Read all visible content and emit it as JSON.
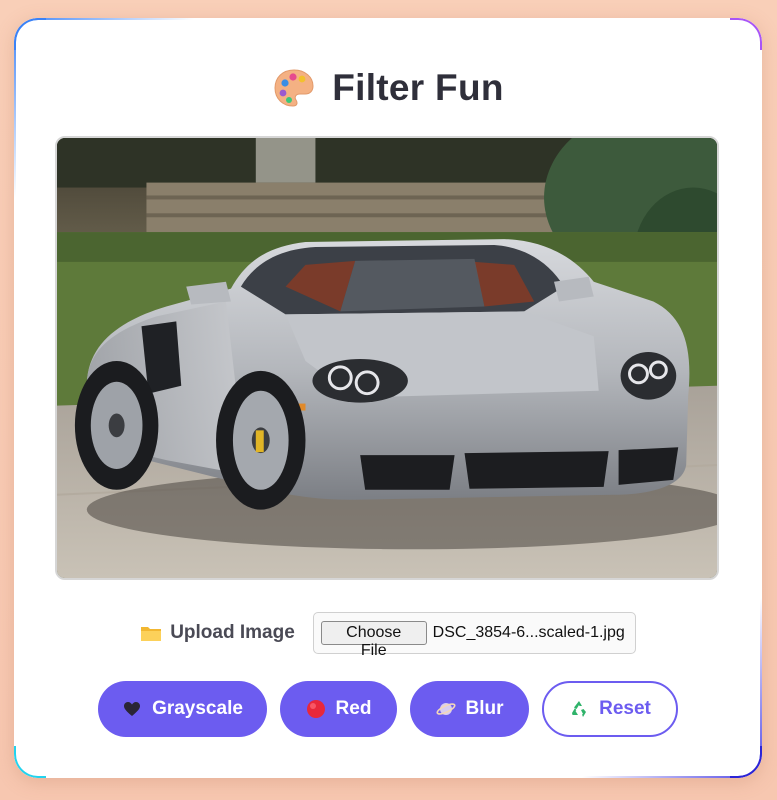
{
  "app": {
    "title": "Filter Fun"
  },
  "upload": {
    "label": "Upload Image",
    "choose_label": "Choose File",
    "file_name": "DSC_3854-6...scaled-1.jpg"
  },
  "filters": {
    "grayscale_label": "Grayscale",
    "red_label": "Red",
    "blur_label": "Blur",
    "reset_label": "Reset"
  },
  "icons": {
    "title": "palette-icon",
    "upload": "folder-icon",
    "grayscale": "black-heart-icon",
    "red": "red-circle-icon",
    "blur": "blur-planet-icon",
    "reset": "recycle-icon"
  },
  "colors": {
    "accent": "#6c5cf0",
    "background": "#f9cfb8",
    "card": "#ffffff",
    "title_text": "#2f2f3a"
  }
}
